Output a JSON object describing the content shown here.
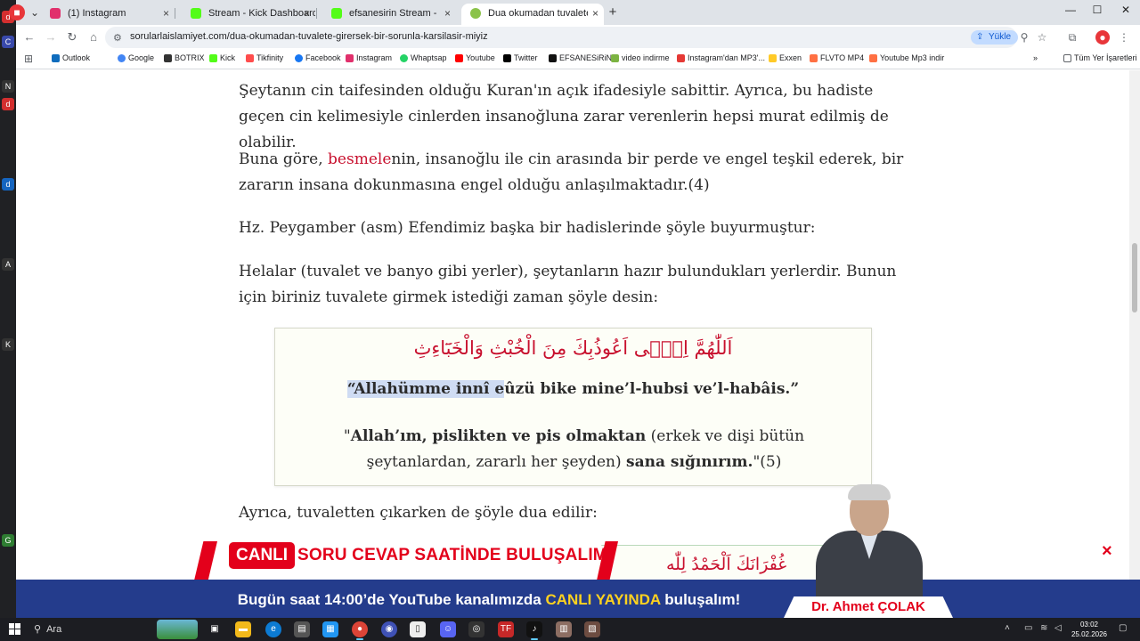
{
  "browser": {
    "tabs": [
      {
        "label": "(1) Instagram",
        "color": "#e1306c",
        "active": false
      },
      {
        "label": "Stream - Kick Dashboard",
        "color": "#53fc18",
        "active": false
      },
      {
        "label": "efsanesirin Stream - Watch Live",
        "color": "#53fc18",
        "active": false
      },
      {
        "label": "Dua okumadan tuvalete girerse",
        "color": "#8bc34a",
        "active": true
      }
    ],
    "new_tab": "+",
    "url": "sorularlaislamiyet.com/dua-okumadan-tuvalete-girersek-bir-sorunla-karsilasir-miyiz",
    "upload_label": "Yükle",
    "bookmarks": [
      {
        "label": "Outlook",
        "color": "#0f6cbd"
      },
      {
        "label": "Google",
        "color": "#4285f4"
      },
      {
        "label": "BOTRIX",
        "color": "#333333"
      },
      {
        "label": "Kick",
        "color": "#53fc18"
      },
      {
        "label": "Tikfinity",
        "color": "#ff4d4d"
      },
      {
        "label": "Facebook",
        "color": "#1877f2"
      },
      {
        "label": "Instagram",
        "color": "#e1306c"
      },
      {
        "label": "Whaptsap",
        "color": "#25d366"
      },
      {
        "label": "Youtube",
        "color": "#ff0000"
      },
      {
        "label": "Twitter",
        "color": "#000000"
      },
      {
        "label": "EFSANESiRiN",
        "color": "#111111"
      },
      {
        "label": "video indirme",
        "color": "#7cb342"
      },
      {
        "label": "Instagram'dan MP3'...",
        "color": "#e53935"
      },
      {
        "label": "Exxen",
        "color": "#ffca28"
      },
      {
        "label": "FLVTO MP4",
        "color": "#ff7043"
      },
      {
        "label": "Youtube Mp3 indir",
        "color": "#ff7043"
      }
    ],
    "all_bookmarks": "Tüm Yer İşaretleri"
  },
  "article": {
    "para1": "Şeytanın cin taifesinden olduğu Kuran'ın açık ifadesiyle sabittir. Ayrıca, bu hadiste geçen cin kelimesiyle cinlerden insanoğluna zarar verenlerin hepsi murat edilmiş de olabilir.",
    "para2_before": "Buna göre, ",
    "para2_link": "besmele",
    "para2_after": "nin, insanoğlu ile cin arasında bir perde ve engel teşkil ederek, bir zararın insana dokunmasına engel olduğu anlaşılmaktadır.(4)",
    "para3": "Hz. Peygamber (asm) Efendimiz başka bir hadislerinde şöyle buyurmuştur:",
    "para4": "Helalar (tuvalet ve banyo gibi yerler), şeytanların hazır bulundukları yerlerdir. Bunun için biriniz tuvalete girmek istediği zaman şöyle desin:",
    "dua_arabic": "اَللّٰهُمَّ اِنّ۪ى اَعُوذُبِكَ مِنَ الْخُبْثِ وَالْخَبَٓاءِثِ",
    "dua_translit_highlighted": "“Allahümme innî e",
    "dua_translit_rest": "ûzü bike mine’l-hubsi ve’l-habâis.”",
    "meaning_q1": "\"",
    "meaning_b1": "Allah’ım, pislikten ve pis olmaktan",
    "meaning_mid": " (erkek ve dişi bütün şeytanlardan, zararlı her şeyden) ",
    "meaning_b2": "sana sığınırım.",
    "meaning_end": "\"(5)",
    "para5": "Ayrıca, tuvaletten çıkarken de şöyle dua edilir:",
    "dua2_arabic": "غُفْرَانَكَ اَلْحَمْدُ لِلّٰه"
  },
  "overlay": {
    "live_badge": "CANLI",
    "title": "SORU CEVAP SAATİNDE BULUŞALIM",
    "sub_before": "Bugün saat 14:00’de YouTube kanalımızda ",
    "sub_highlight": "CANLI YAYINDA",
    "sub_after": " buluşalım!",
    "name": "Dr. Ahmet ÇOLAK",
    "close": "×"
  },
  "taskbar": {
    "search_label": "Ara",
    "time": "03:02",
    "date": "25.02.2026"
  }
}
